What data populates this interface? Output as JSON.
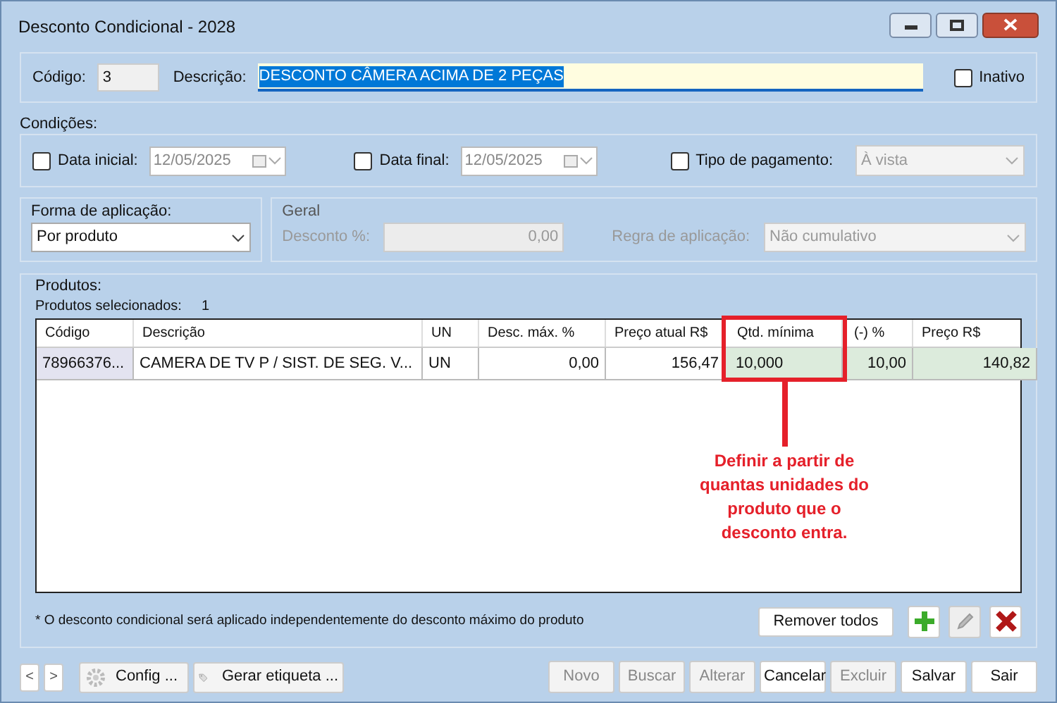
{
  "window": {
    "title": "Desconto Condicional - 2028"
  },
  "header": {
    "codigo_label": "Código:",
    "codigo": "3",
    "descricao_label": "Descrição:",
    "descricao": "DESCONTO CÂMERA ACIMA DE 2 PEÇAS",
    "inativo": {
      "label": "Inativo",
      "checked": false
    }
  },
  "condicoes": {
    "title": "Condições:",
    "items": [
      {
        "kind": "date",
        "label": "Data inicial:",
        "checked": false,
        "value": "12/05/2025"
      },
      {
        "kind": "date",
        "label": "Data final:",
        "checked": false,
        "value": "12/05/2025"
      },
      {
        "kind": "select",
        "label": "Tipo de pagamento:",
        "checked": false,
        "value": "À vista"
      }
    ]
  },
  "forma": {
    "title": "Forma de aplicação:",
    "value": "Por produto"
  },
  "geral": {
    "title": "Geral",
    "desconto_label": "Desconto %:",
    "desconto": "0,00",
    "regra_label": "Regra de aplicação:",
    "regra": "Não cumulativo",
    "disabled": true
  },
  "produtos": {
    "title": "Produtos:",
    "count_label": "Produtos selecionados:",
    "count": "1",
    "columns": [
      "Código",
      "Descrição",
      "UN",
      "Desc. máx. %",
      "Preço atual R$",
      "Qtd. mínima",
      "(-) %",
      "Preço R$"
    ],
    "rows": [
      [
        "78966376...",
        "CAMERA DE TV P / SIST. DE SEG. V...",
        "UN",
        "0,00",
        "156,47",
        "10,000",
        "10,00",
        "140,82"
      ]
    ],
    "note": "* O desconto condicional será aplicado independentemente do desconto máximo do produto",
    "remove_all": "Remover todos"
  },
  "annotation": {
    "text": "Definir a partir de quantas unidades do produto que o desconto entra."
  },
  "footer": {
    "nav": [
      "<",
      ">"
    ],
    "config": "Config ...",
    "etiqueta": "Gerar etiqueta ...",
    "buttons": [
      {
        "label": "Novo",
        "disabled": true
      },
      {
        "label": "Buscar",
        "disabled": true
      },
      {
        "label": "Alterar",
        "disabled": true
      },
      {
        "label": "Cancelar",
        "disabled": false
      },
      {
        "label": "Excluir",
        "disabled": true
      },
      {
        "label": "Salvar",
        "disabled": false
      },
      {
        "label": "Sair",
        "disabled": false
      }
    ]
  }
}
